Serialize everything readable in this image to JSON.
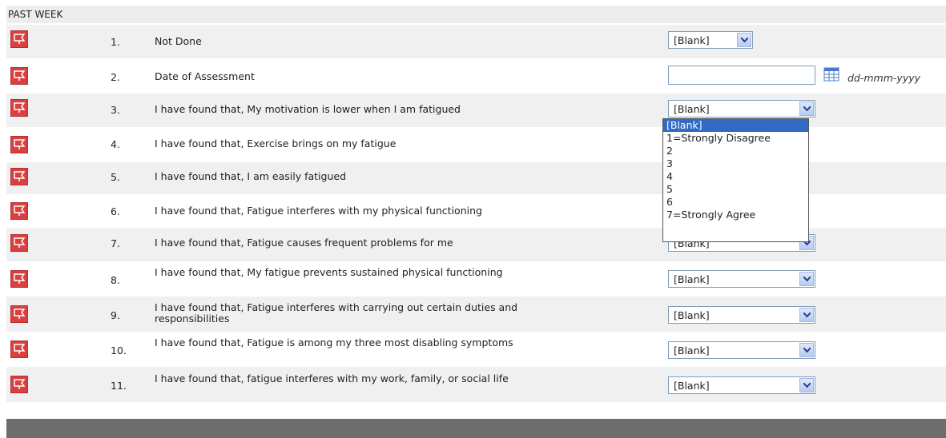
{
  "section": {
    "title": "PAST WEEK"
  },
  "date_hint": "dd-mmm-yyyy",
  "questions": [
    {
      "num": "1.",
      "text": "Not Done",
      "value": "[Blank]"
    },
    {
      "num": "2.",
      "text": "Date of Assessment",
      "value": ""
    },
    {
      "num": "3.",
      "text": "I have found that, My motivation is lower when I am fatigued",
      "value": "[Blank]"
    },
    {
      "num": "4.",
      "text": "I have found that, Exercise brings on my fatigue",
      "value": ""
    },
    {
      "num": "5.",
      "text": "I have found that, I am easily fatigued",
      "value": ""
    },
    {
      "num": "6.",
      "text": "I have found that, Fatigue interferes with my physical functioning",
      "value": ""
    },
    {
      "num": "7.",
      "text": "I have found that, Fatigue causes frequent problems for me",
      "value": "[Blank]"
    },
    {
      "num": "8.",
      "text": "I have found that, My fatigue prevents sustained physical functioning",
      "value": "[Blank]"
    },
    {
      "num": "9.",
      "text": "I have found that, Fatigue interferes with carrying out certain duties and responsibilities",
      "value": "[Blank]"
    },
    {
      "num": "10.",
      "text": "I have found that, Fatigue is among my three most disabling symptoms",
      "value": "[Blank]"
    },
    {
      "num": "11.",
      "text": "I have found that, fatigue interferes with my work, family, or social life",
      "value": "[Blank]"
    }
  ],
  "dropdown_options": [
    "[Blank]",
    "1=Strongly Disagree",
    "2",
    "3",
    "4",
    "5",
    "6",
    "7=Strongly Agree"
  ],
  "dropdown_selected": "[Blank]",
  "colors": {
    "flag": "#d94040",
    "row_shade": "#f0f0f0",
    "footer": "#6e6e6e",
    "highlight": "#316ac5"
  }
}
